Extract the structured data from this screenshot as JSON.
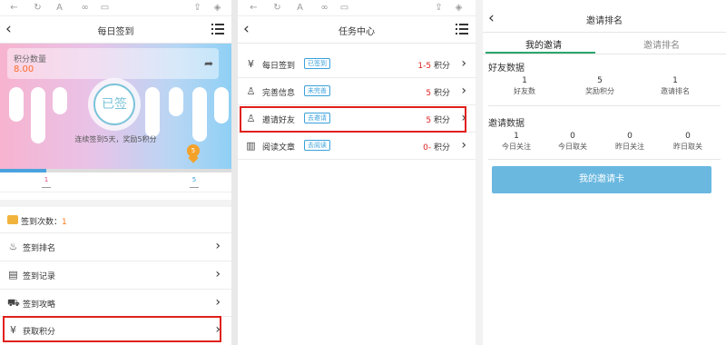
{
  "panel1": {
    "title": "每日签到",
    "points_label": "积分数量",
    "points_value": "8.00",
    "signed_text": "已签",
    "streak_text": "连续签到5天，奖励5积分",
    "pin_value": "5",
    "progress_fraction": 0.2,
    "tick_start": "1",
    "tick_end": "5",
    "count_label": "签到次数：",
    "count_value": "1",
    "menu": [
      {
        "label": "签到排名",
        "icon": "fire-icon"
      },
      {
        "label": "签到记录",
        "icon": "record-icon"
      },
      {
        "label": "签到攻略",
        "icon": "guide-icon"
      },
      {
        "label": "获取积分",
        "icon": "yen-icon"
      }
    ]
  },
  "panel2": {
    "title": "任务中心",
    "tasks": [
      {
        "label": "每日签到",
        "badge": "已签到",
        "points": "1-5",
        "unit": "积分",
        "icon": "yen-icon"
      },
      {
        "label": "完善信息",
        "badge": "未完善",
        "points": "5",
        "unit": "积分",
        "icon": "user-icon"
      },
      {
        "label": "邀请好友",
        "badge": "去邀请",
        "points": "5",
        "unit": "积分",
        "icon": "user-add-icon"
      },
      {
        "label": "阅读文章",
        "badge": "去阅读",
        "points": "0-",
        "unit": "积分",
        "icon": "book-icon"
      }
    ]
  },
  "panel3": {
    "title": "邀请排名",
    "tabs": [
      "我的邀请",
      "邀请排名"
    ],
    "friends_header": "好友数据",
    "friends_stats": [
      {
        "value": "1",
        "label": "好友数"
      },
      {
        "value": "5",
        "label": "奖励积分"
      },
      {
        "value": "1",
        "label": "邀请排名"
      }
    ],
    "invite_header": "邀请数据",
    "invite_stats": [
      {
        "value": "1",
        "label": "今日关注"
      },
      {
        "value": "0",
        "label": "今日取关"
      },
      {
        "value": "0",
        "label": "昨日关注"
      },
      {
        "value": "0",
        "label": "昨日取关"
      }
    ],
    "button_label": "我的邀请卡"
  },
  "colors": {
    "accent_blue": "#3aa1dc",
    "highlight_red": "#e0201c",
    "tab_green": "#2ca56b",
    "points_orange": "#ff6a2a"
  }
}
